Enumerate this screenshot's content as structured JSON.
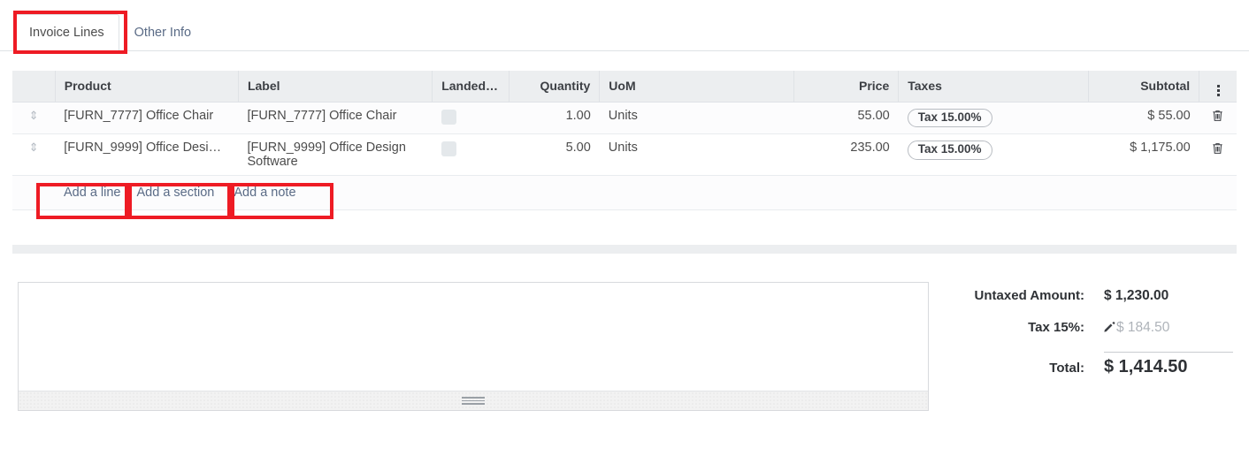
{
  "tabs": [
    {
      "label": "Invoice Lines",
      "active": true
    },
    {
      "label": "Other Info",
      "active": false
    }
  ],
  "table": {
    "columns": [
      {
        "key": "handle",
        "label": "",
        "align": "center"
      },
      {
        "key": "product",
        "label": "Product",
        "align": "left"
      },
      {
        "key": "label",
        "label": "Label",
        "align": "left"
      },
      {
        "key": "landed",
        "label": "Landed…",
        "align": "left"
      },
      {
        "key": "quantity",
        "label": "Quantity",
        "align": "right"
      },
      {
        "key": "uom",
        "label": "UoM",
        "align": "left"
      },
      {
        "key": "price",
        "label": "Price",
        "align": "right"
      },
      {
        "key": "taxes",
        "label": "Taxes",
        "align": "left"
      },
      {
        "key": "subtotal",
        "label": "Subtotal",
        "align": "right"
      },
      {
        "key": "options",
        "label": "",
        "align": "center"
      }
    ],
    "rows": [
      {
        "product": "[FURN_7777] Office Chair",
        "label": "[FURN_7777] Office Chair",
        "landed_checked": false,
        "quantity": "1.00",
        "uom": "Units",
        "price": "55.00",
        "taxes": "Tax 15.00%",
        "subtotal": "$ 55.00"
      },
      {
        "product": "[FURN_9999] Office Desi…",
        "label": "[FURN_9999] Office Design Software",
        "landed_checked": false,
        "quantity": "5.00",
        "uom": "Units",
        "price": "235.00",
        "taxes": "Tax 15.00%",
        "subtotal": "$ 1,175.00"
      }
    ],
    "add_buttons": [
      {
        "label": "Add a line"
      },
      {
        "label": "Add a section"
      },
      {
        "label": "Add a note"
      }
    ]
  },
  "note": {
    "value": "",
    "placeholder": ""
  },
  "totals": {
    "untaxed_label": "Untaxed Amount:",
    "untaxed_value": "$ 1,230.00",
    "tax_label": "Tax 15%:",
    "tax_value": "$ 184.50",
    "total_label": "Total:",
    "total_value": "$ 1,414.50"
  },
  "icons": {
    "drag_handle": "⇕",
    "options_menu": "vertical-dots",
    "delete": "trash-icon",
    "edit": "pencil-icon",
    "resize": "resize-grip"
  },
  "colors": {
    "annotation_red": "#ee1b24",
    "header_bg": "#eceef0",
    "link_blue": "#5a6b86",
    "muted_gray": "#aeb3b9"
  }
}
